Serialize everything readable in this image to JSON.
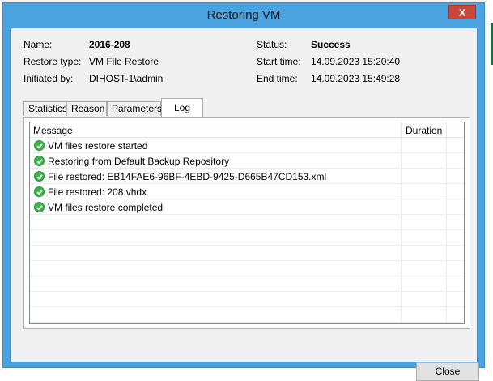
{
  "window": {
    "title": "Restoring VM",
    "close_glyph": "X"
  },
  "info": {
    "name_label": "Name:",
    "name_value": "2016-208",
    "restore_type_label": "Restore type:",
    "restore_type_value": "VM File Restore",
    "initiated_by_label": "Initiated by:",
    "initiated_by_value": "DIHOST-1\\admin",
    "status_label": "Status:",
    "status_value": "Success",
    "start_time_label": "Start time:",
    "start_time_value": "14.09.2023 15:20:40",
    "end_time_label": "End time:",
    "end_time_value": "14.09.2023 15:49:28"
  },
  "tabs": [
    {
      "label": "Statistics",
      "active": false
    },
    {
      "label": "Reason",
      "active": false
    },
    {
      "label": "Parameters",
      "active": false
    },
    {
      "label": "Log",
      "active": true
    }
  ],
  "log": {
    "columns": [
      "Message",
      "Duration"
    ],
    "rows": [
      {
        "icon": "success-check-icon",
        "message": "VM files restore started",
        "duration": ""
      },
      {
        "icon": "success-check-icon",
        "message": "Restoring from Default Backup Repository",
        "duration": ""
      },
      {
        "icon": "success-check-icon",
        "message": "File restored: EB14FAE6-96BF-4EBD-9425-D665B47CD153.xml",
        "duration": ""
      },
      {
        "icon": "success-check-icon",
        "message": "File restored: 208.vhdx",
        "duration": ""
      },
      {
        "icon": "success-check-icon",
        "message": "VM files restore completed",
        "duration": ""
      }
    ]
  },
  "buttons": {
    "close_label": "Close"
  },
  "colors": {
    "title_bar": "#4aa3df",
    "close_button": "#c9463a",
    "success": "#3bb44a",
    "dialog_bg": "#f0f0f0"
  }
}
